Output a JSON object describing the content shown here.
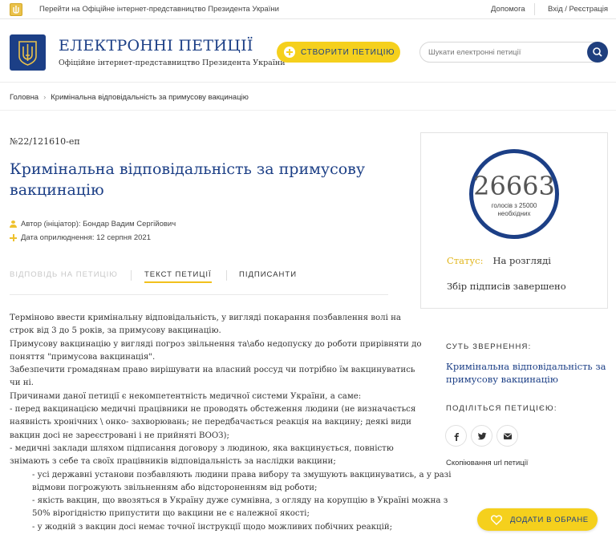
{
  "topbar": {
    "president_link": "Перейти на Офіційне інтернет-представництво Президента України",
    "help": "Допомога",
    "login": "Вхід / Реєстрація"
  },
  "header": {
    "title": "ЕЛЕКТРОННІ ПЕТИЦІЇ",
    "subtitle": "Офіційне інтернет-представництво Президента України",
    "create_button": "СТВОРИТИ ПЕТИЦІЮ",
    "search_placeholder": "Шукати електронні петиції"
  },
  "breadcrumb": {
    "home": "Головна",
    "current": "Кримінальна відповідальність за примусову вакцинацію"
  },
  "petition": {
    "number": "№22/121610-еп",
    "title": "Кримінальна відповідальність за примусову вакцинацію",
    "author": "Автор (ініціатор): Бондар Вадим Сергійович",
    "date": "Дата оприлюднення: 12 серпня 2021",
    "tabs": [
      "ВІДПОВІДЬ НА ПЕТИЦІЮ",
      "ТЕКСТ ПЕТИЦІЇ",
      "ПІДПИСАНТИ"
    ],
    "active_tab": "ТЕКСТ ПЕТИЦІЇ",
    "text_lines": [
      "Терміново ввести кримінальну відповідальність, у вигляді покарання позбавлення волі на",
      "строк від 3 до 5 років, за примусову вакцинацію.",
      "Примусову вакцинацію у вигляді погроз звільнення та\\або недопуску до роботи прирівняти до",
      "поняття \"примусова вакцинація\".",
      "Забезпечити громадянам право вирішувати на власний россуд чи потрібно їм вакцинуватись",
      "чи ні.",
      "Причинами даної петиції є некомпетентність медичної системи України, а саме:",
      "- перед вакцинацією медичні працівники не проводять обстеження людини (не визначається",
      "наявність хронічних \\ онко- захворювань; не передбачається реакція на вакцину; деякі види",
      "вакцин досі не зареєстровані і не прийняті ВООЗ);",
      "- медичні заклади шляхом підписання договору з людиною, яка вакцинується, повністю",
      "знімають з себе та своїх працівників відповідальність за наслідки вакцини;"
    ],
    "indented_lines": [
      "- усі державні установи позбавляють людини права вибору та змушують вакцинуватись, а у разі",
      "відмови погрожують звільненням або відстороненням від роботи;",
      "- якість вакцин, що ввозяться в Україну дуже сумнівна, з огляду на корупцію в Україні можна з",
      "50% вірогідністю припустити що вакцини не є належної якості;",
      "- у жодній з вакцин досі немає точної інструкції щодо можливих побічних реакцій;"
    ]
  },
  "sidebar": {
    "votes": "26663",
    "votes_of": "голосів з 25000",
    "votes_needed": "необхідних",
    "status_label": "Статус:",
    "status_value": "На розгляді",
    "collection_status": "Збір підписів завершено",
    "essence_heading": "СУТЬ ЗВЕРНЕННЯ:",
    "essence_text": "Кримінальна відповідальність за примусову вакцинацію",
    "share_heading": "ПОДІЛІТЬСЯ ПЕТИЦІЄЮ:",
    "social": [
      "facebook-icon",
      "twitter-icon",
      "email-icon"
    ],
    "copy_url": "Скопіювання url петиції",
    "favorite_button": "ДОДАТИ В ОБРАНЕ"
  },
  "colors": {
    "brand_blue": "#1c3f86",
    "accent_yellow": "#f5d01d",
    "status_label": "#e1b51a"
  }
}
